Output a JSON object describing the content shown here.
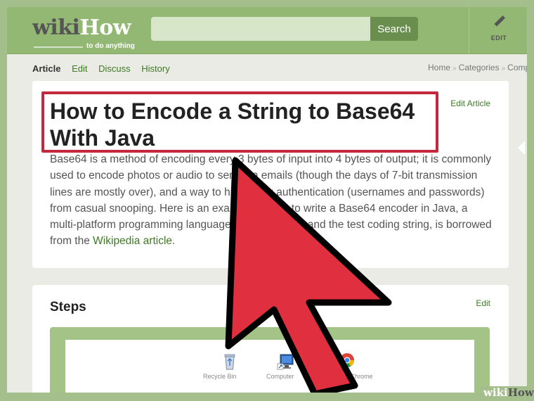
{
  "header": {
    "logo_wiki": "wiki",
    "logo_how": "How",
    "logo_tagline": "to do anything",
    "search_placeholder": "",
    "search_button": "Search",
    "edit_label": "EDIT"
  },
  "nav": {
    "tabs": [
      "Article",
      "Edit",
      "Discuss",
      "History"
    ],
    "breadcrumb": [
      "Home",
      "Categories",
      "Comp"
    ]
  },
  "article": {
    "edit_link": "Edit Article",
    "title": "How to Encode a String to Base64 With Java",
    "intro_before_link": "Base64 is a method of encoding every 3 bytes of input into 4 bytes of output; it is commonly used to encode photos or audio to send via emails (though the days of 7-bit transmission lines are mostly over), and a way to hide weak authentication (usernames and passwords) from casual snooping. Here is an example of how to write a Base64 encoder in Java, a multi-platform programming language. This example, and the test coding string, is borrowed from the ",
    "intro_link": "Wikipedia article",
    "intro_after_link": "."
  },
  "steps": {
    "heading": "Steps",
    "edit_link": "Edit",
    "desktop_icons": [
      {
        "name": "recycle-bin-icon",
        "label": "Recycle Bin"
      },
      {
        "name": "computer-icon",
        "label": "Computer"
      },
      {
        "name": "chrome-icon",
        "label": "Google Chrome"
      }
    ]
  },
  "overlay": {
    "cursor_color": "#e0303f",
    "highlight_color": "#c5283d"
  },
  "watermark": {
    "wiki": "wiki",
    "how": "How"
  }
}
